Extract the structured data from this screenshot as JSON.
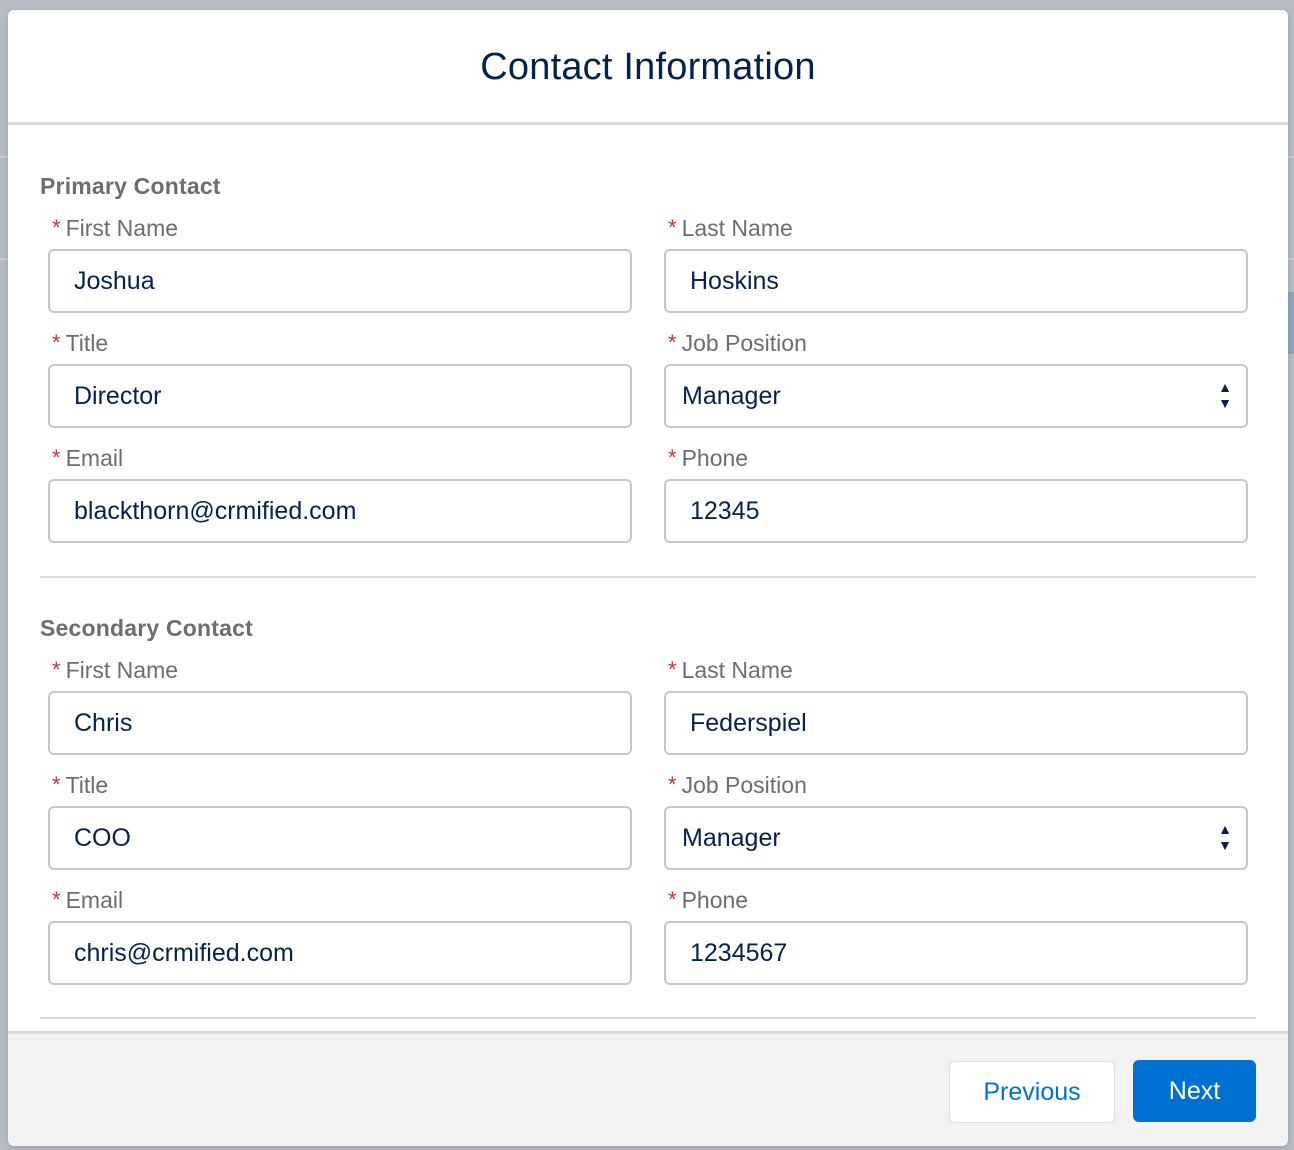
{
  "modal": {
    "title": "Contact Information"
  },
  "primary": {
    "title": "Primary Contact",
    "fields": {
      "first_name": {
        "label": "First Name",
        "value": "Joshua"
      },
      "last_name": {
        "label": "Last Name",
        "value": "Hoskins"
      },
      "title": {
        "label": "Title",
        "value": "Director"
      },
      "job_position": {
        "label": "Job Position",
        "value": "Manager"
      },
      "email": {
        "label": "Email",
        "value": "blackthorn@crmified.com"
      },
      "phone": {
        "label": "Phone",
        "value": "12345"
      }
    }
  },
  "secondary": {
    "title": "Secondary Contact",
    "fields": {
      "first_name": {
        "label": "First Name",
        "value": "Chris"
      },
      "last_name": {
        "label": "Last Name",
        "value": "Federspiel"
      },
      "title": {
        "label": "Title",
        "value": "COO"
      },
      "job_position": {
        "label": "Job Position",
        "value": "Manager"
      },
      "email": {
        "label": "Email",
        "value": "chris@crmified.com"
      },
      "phone": {
        "label": "Phone",
        "value": "1234567"
      }
    }
  },
  "required_marker": "*",
  "stepper": {
    "up": "▲",
    "down": "▼"
  },
  "footer": {
    "previous_label": "Previous",
    "next_label": "Next"
  },
  "colors": {
    "title": "#03234d",
    "accent": "#0070d2",
    "required": "#c23934",
    "label": "#6b6d70"
  }
}
